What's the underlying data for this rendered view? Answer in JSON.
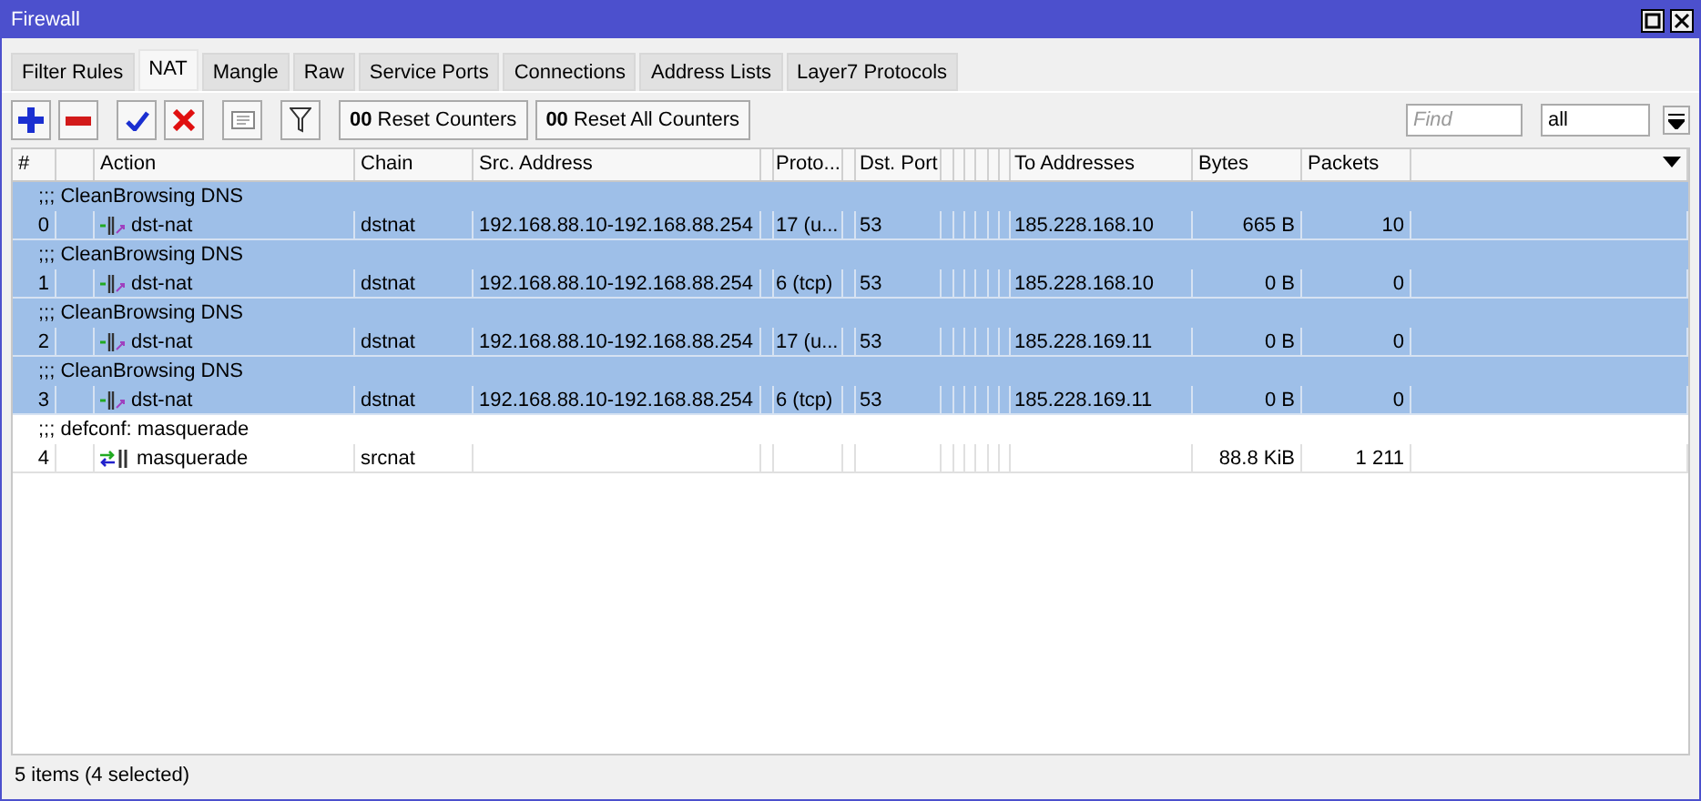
{
  "window": {
    "title": "Firewall"
  },
  "tabs": [
    {
      "label": "Filter Rules",
      "selected": false
    },
    {
      "label": "NAT",
      "selected": true
    },
    {
      "label": "Mangle",
      "selected": false
    },
    {
      "label": "Raw",
      "selected": false
    },
    {
      "label": "Service Ports",
      "selected": false
    },
    {
      "label": "Connections",
      "selected": false
    },
    {
      "label": "Address Lists",
      "selected": false
    },
    {
      "label": "Layer7 Protocols",
      "selected": false
    }
  ],
  "toolbar": {
    "buttons": [
      {
        "kind": "add"
      },
      {
        "kind": "remove"
      },
      {
        "kind": "enable"
      },
      {
        "kind": "disable"
      },
      {
        "kind": "comment"
      },
      {
        "kind": "filter"
      },
      {
        "kind": "text",
        "prefix": "00",
        "label": "Reset Counters"
      },
      {
        "kind": "text",
        "prefix": "00",
        "label": "Reset All Counters"
      }
    ],
    "search": {
      "placeholder": "Find"
    },
    "filter_select": {
      "value": "all"
    }
  },
  "table": {
    "columns": [
      "#",
      "",
      "Action",
      "Chain",
      "Src. Address",
      "",
      "Proto...",
      "",
      "Dst. Port",
      "",
      "",
      "",
      "",
      "",
      "",
      "To Addresses",
      "Bytes",
      "Packets"
    ],
    "rows": [
      {
        "comment": ";;; CleanBrowsing DNS",
        "number": "0",
        "kind": "dstnat",
        "action": "dst-nat",
        "chain": "dstnat",
        "src": "192.168.88.10-192.168.88.254",
        "proto": "17 (u...",
        "dst_port": "53",
        "to_addresses": "185.228.168.10",
        "bytes": "665 B",
        "packets": "10",
        "selected": true
      },
      {
        "comment": ";;; CleanBrowsing DNS",
        "number": "1",
        "kind": "dstnat",
        "action": "dst-nat",
        "chain": "dstnat",
        "src": "192.168.88.10-192.168.88.254",
        "proto": "6 (tcp)",
        "dst_port": "53",
        "to_addresses": "185.228.168.10",
        "bytes": "0 B",
        "packets": "0",
        "selected": true
      },
      {
        "comment": ";;; CleanBrowsing DNS",
        "number": "2",
        "kind": "dstnat",
        "action": "dst-nat",
        "chain": "dstnat",
        "src": "192.168.88.10-192.168.88.254",
        "proto": "17 (u...",
        "dst_port": "53",
        "to_addresses": "185.228.169.11",
        "bytes": "0 B",
        "packets": "0",
        "selected": true
      },
      {
        "comment": ";;; CleanBrowsing DNS",
        "number": "3",
        "kind": "dstnat",
        "action": "dst-nat",
        "chain": "dstnat",
        "src": "192.168.88.10-192.168.88.254",
        "proto": "6 (tcp)",
        "dst_port": "53",
        "to_addresses": "185.228.169.11",
        "bytes": "0 B",
        "packets": "0",
        "selected": true
      },
      {
        "comment": ";;; defconf: masquerade",
        "number": "4",
        "kind": "masquerade",
        "action": "masquerade",
        "chain": "srcnat",
        "src": "",
        "proto": "",
        "dst_port": "",
        "to_addresses": "",
        "bytes": "88.8 KiB",
        "packets": "1 211",
        "selected": false
      }
    ]
  },
  "status_bar": "5 items (4 selected)"
}
